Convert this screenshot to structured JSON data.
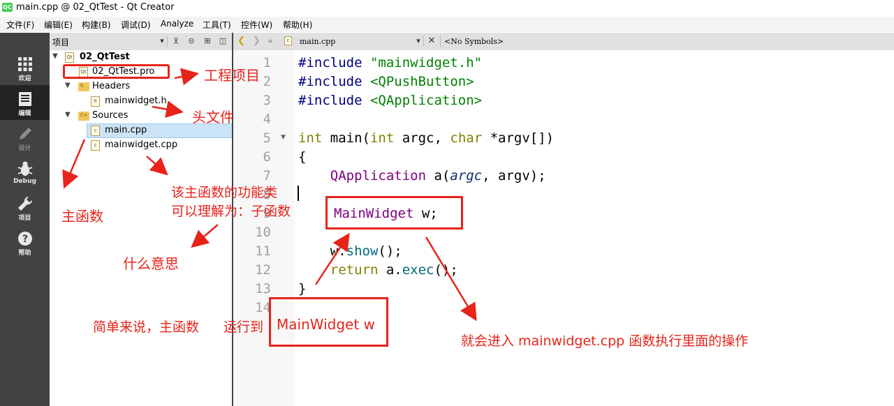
{
  "window": {
    "title": "main.cpp @ 02_QtTest - Qt Creator",
    "logo": "QC"
  },
  "menu": [
    "文件(F)",
    "编辑(E)",
    "构建(B)",
    "调试(D)",
    "Analyze",
    "工具(T)",
    "控件(W)",
    "帮助(H)"
  ],
  "modes": [
    {
      "label": "欢迎",
      "icon": "grid-icon"
    },
    {
      "label": "编辑",
      "icon": "edit-document-icon"
    },
    {
      "label": "设计",
      "icon": "pencil-icon"
    },
    {
      "label": "Debug",
      "icon": "bug-icon"
    },
    {
      "label": "项目",
      "icon": "wrench-icon"
    },
    {
      "label": "帮助",
      "icon": "help-icon"
    }
  ],
  "project_pane": {
    "title": "项目",
    "tree": {
      "project": "02_QtTest",
      "pro_file": "02_QtTest.pro",
      "headers_label": "Headers",
      "header_file": "mainwidget.h",
      "sources_label": "Sources",
      "source_files": [
        "main.cpp",
        "mainwidget.cpp"
      ]
    }
  },
  "editor": {
    "file_combo": "main.cpp",
    "symbols_combo": "<No Symbols>",
    "line_numbers": [
      "1",
      "2",
      "3",
      "4",
      "5",
      "6",
      "7",
      "8",
      "9",
      "10",
      "11",
      "12",
      "13",
      "14"
    ],
    "code": {
      "l1a": "#include ",
      "l1b": "\"mainwidget.h\"",
      "l2a": "#include ",
      "l2b": "<QPushButton>",
      "l3a": "#include ",
      "l3b": "<QApplication>",
      "l5a": "int",
      "l5b": " main(",
      "l5c": "int",
      "l5d": " argc, ",
      "l5e": "char",
      "l5f": " *argv[])",
      "l6": "{",
      "l7a": "    QApplication",
      "l7b": " a(",
      "l7c": "argc",
      "l7d": ", argv);",
      "l9a": "MainWidget",
      "l9b": " w;",
      "l11a": "    w.",
      "l11b": "show",
      "l11c": "();",
      "l12a": "    return",
      "l12b": " a.",
      "l12c": "exec",
      "l12d": "();",
      "l13": "}"
    }
  },
  "annotations": {
    "project_item": "工程项目",
    "header_file": "头文件",
    "main_function": "主函数",
    "function_class_1": "该主函数的功能类",
    "function_class_2": "可以理解为：子函数",
    "what_meaning": "什么意思",
    "simple_1": "简单来说，主函数",
    "simple_2": "运行到",
    "boxed_label": "MainWidget w",
    "enter": "就会进入 mainwidget.cpp  函数执行里面的操作"
  },
  "colors": {
    "annotation": "#e8231a",
    "modebar": "#404244",
    "selection": "#cce4f7"
  }
}
